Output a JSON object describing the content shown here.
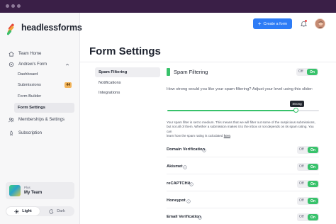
{
  "colors": {
    "titlebar": "#3a1f47",
    "accent_green": "#38c26b",
    "primary_blue": "#2e7cf6",
    "badge_orange": "#f3b55c",
    "logo_red": "#e5483a",
    "logo_orange": "#f2a23a",
    "logo_green": "#3bbf6a"
  },
  "brand": {
    "name": "headlessforms",
    "logo_icon": "headlessforms-logo"
  },
  "header": {
    "create_button_label": "Create a form",
    "create_button_icon": "plus-icon",
    "notification_icon": "bell-icon",
    "avatar_icon": "user-avatar"
  },
  "sidebar": {
    "team_home": {
      "label": "Team Home",
      "icon": "home-icon"
    },
    "form_group": {
      "label": "Andrew's Form",
      "icon": "gear-icon",
      "items": [
        {
          "label": "Dashboard"
        },
        {
          "label": "Submissions",
          "badge": "44"
        },
        {
          "label": "Form Builder"
        },
        {
          "label": "Form Settings",
          "active": true
        }
      ]
    },
    "memberships": {
      "label": "Memberships & Settings",
      "icon": "users-icon"
    },
    "subscription": {
      "label": "Subscription",
      "icon": "rocket-icon"
    },
    "team": {
      "plan": "Plus",
      "name": "My Team"
    },
    "theme": {
      "light": "Light",
      "dark": "Dark",
      "selected": "Light"
    }
  },
  "page": {
    "title": "Form Settings",
    "settings_nav": [
      "Spam Filtering",
      "Notifications",
      "Integrations"
    ],
    "section": {
      "title": "Spam Filtering",
      "enabled": true,
      "question": "How strong would you like your spam filtering? Adjust your level using this slider:",
      "slider": {
        "value_label": "Strong",
        "level_fraction": 0.85
      },
      "explanation_lines": [
        "Your spam filter is set to medium. This means that we will filter out some of the suspicious submissions,",
        "but not all of them. Whether a submission makes it to the inbox or not depends on its spam rating. You can",
        "learn how the spam rating is calculated"
      ],
      "explanation_link": "here",
      "explanation_end": "."
    },
    "toggle_labels": {
      "off": "Off",
      "on": "On"
    },
    "options": [
      {
        "label": "Domain Verification",
        "on": true
      },
      {
        "label": "Akismet",
        "on": true
      },
      {
        "label": "reCAPTCHA",
        "on": true
      },
      {
        "label": "Honeypot",
        "on": true
      },
      {
        "label": "Email Verification",
        "on": true
      }
    ]
  }
}
